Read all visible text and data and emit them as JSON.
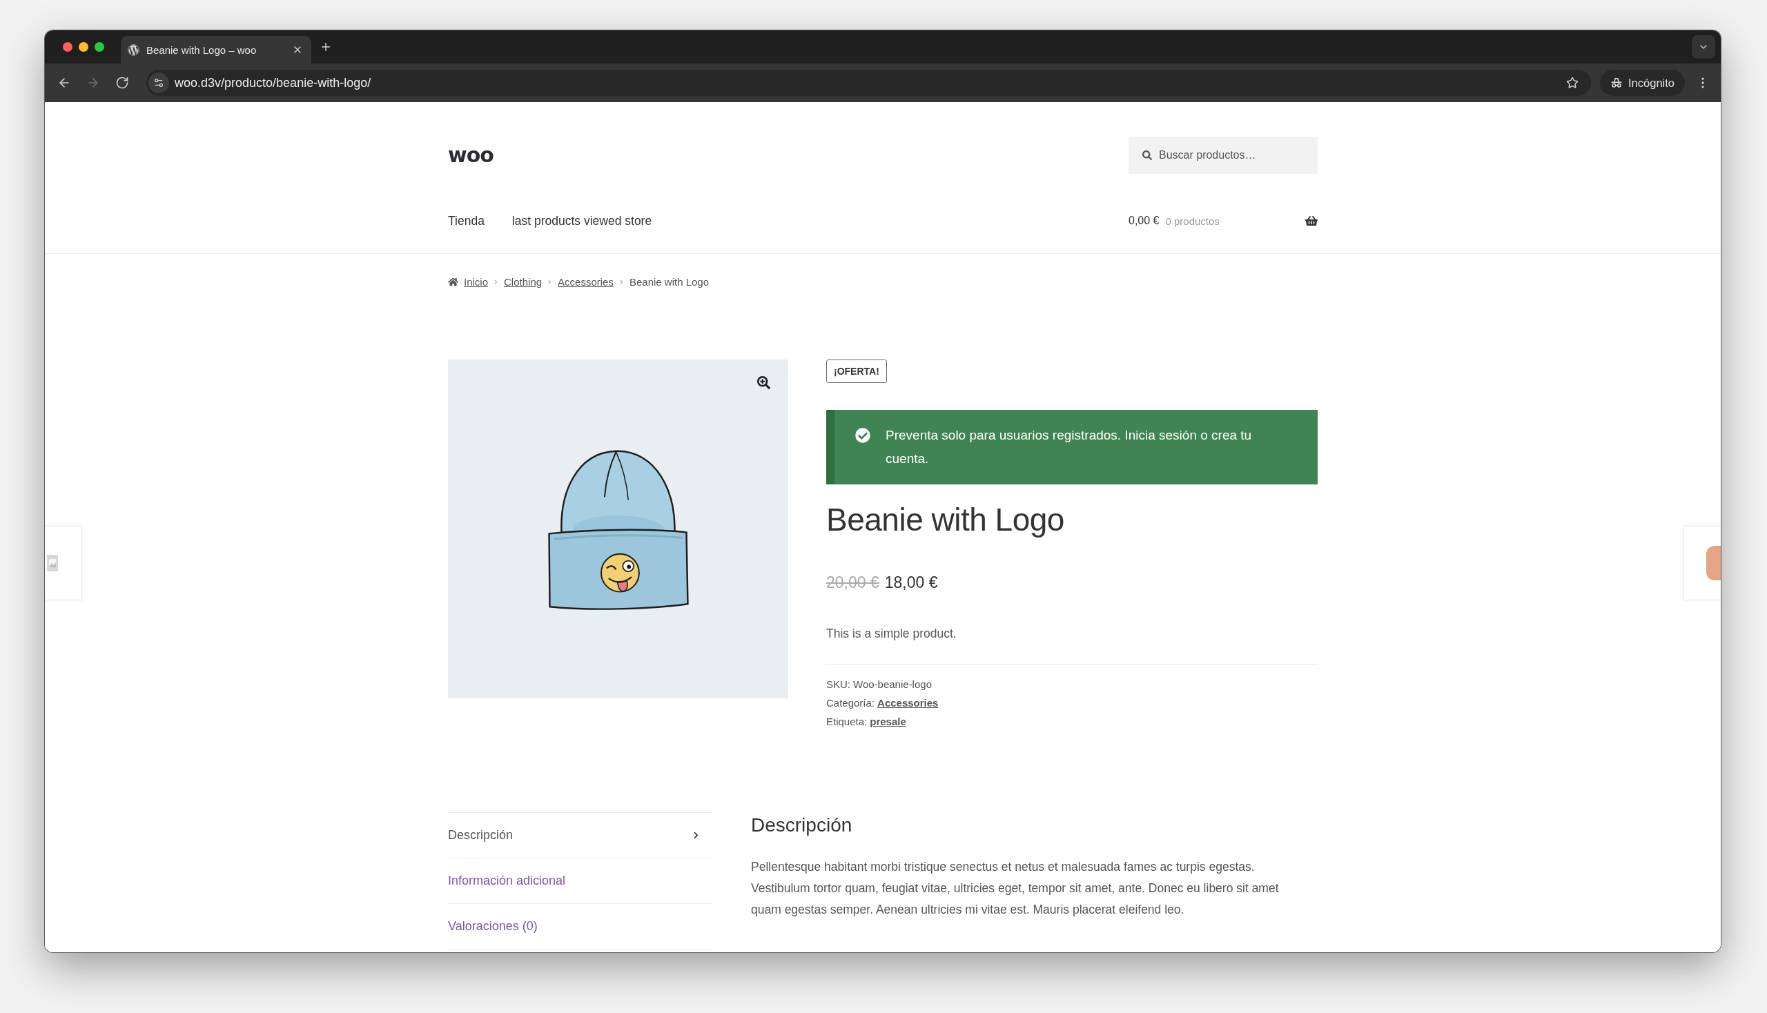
{
  "browser": {
    "tab": {
      "title": "Beanie with Logo – woo"
    },
    "nav_buttons": [
      {
        "kind": "back",
        "disabled": false
      },
      {
        "kind": "forward",
        "disabled": true
      },
      {
        "kind": "reload",
        "disabled": false
      }
    ],
    "url": "woo.d3v/producto/beanie-with-logo/",
    "profile": "Incógnito"
  },
  "header": {
    "logo": "woo",
    "search": {
      "placeholder": "Buscar productos…"
    },
    "nav": [
      "Tienda",
      "last products viewed store"
    ],
    "cart": {
      "total": "0,00 €",
      "count": "0 productos"
    }
  },
  "breadcrumb": [
    {
      "label": "Inicio",
      "current": false
    },
    {
      "label": "Clothing",
      "current": false
    },
    {
      "label": "Accessories",
      "current": false
    },
    {
      "label": "Beanie with Logo",
      "current": true
    }
  ],
  "product": {
    "badge": "¡OFERTA!",
    "notice": "Preventa solo para usuarios registrados. Inicia sesión o crea tu cuenta.",
    "title": "Beanie with Logo",
    "regular_price": "20,00 €",
    "sale_price": "18,00 €",
    "short_description": "This is a simple product.",
    "meta": [
      {
        "label": "SKU:",
        "value": "Woo-beanie-logo",
        "kind": "text"
      },
      {
        "label": "Categoría:",
        "value": "Accessories",
        "kind": "link"
      },
      {
        "label": "Etiqueta:",
        "value": "presale",
        "kind": "link"
      }
    ]
  },
  "tabs": [
    {
      "label": "Descripción",
      "selected": true
    },
    {
      "label": "Información adicional",
      "selected": false
    },
    {
      "label": "Valoraciones (0)",
      "selected": false
    }
  ],
  "description": {
    "heading": "Descripción",
    "text": "Pellentesque habitant morbi tristique senectus et netus et malesuada fames ac turpis egestas. Vestibulum tortor quam, feugiat vitae, ultricies eget, tempor sit amet, ante. Donec eu libero sit amet quam egestas semper. Aenean ultricies mi vitae est. Mauris placerat eleifend leo."
  }
}
